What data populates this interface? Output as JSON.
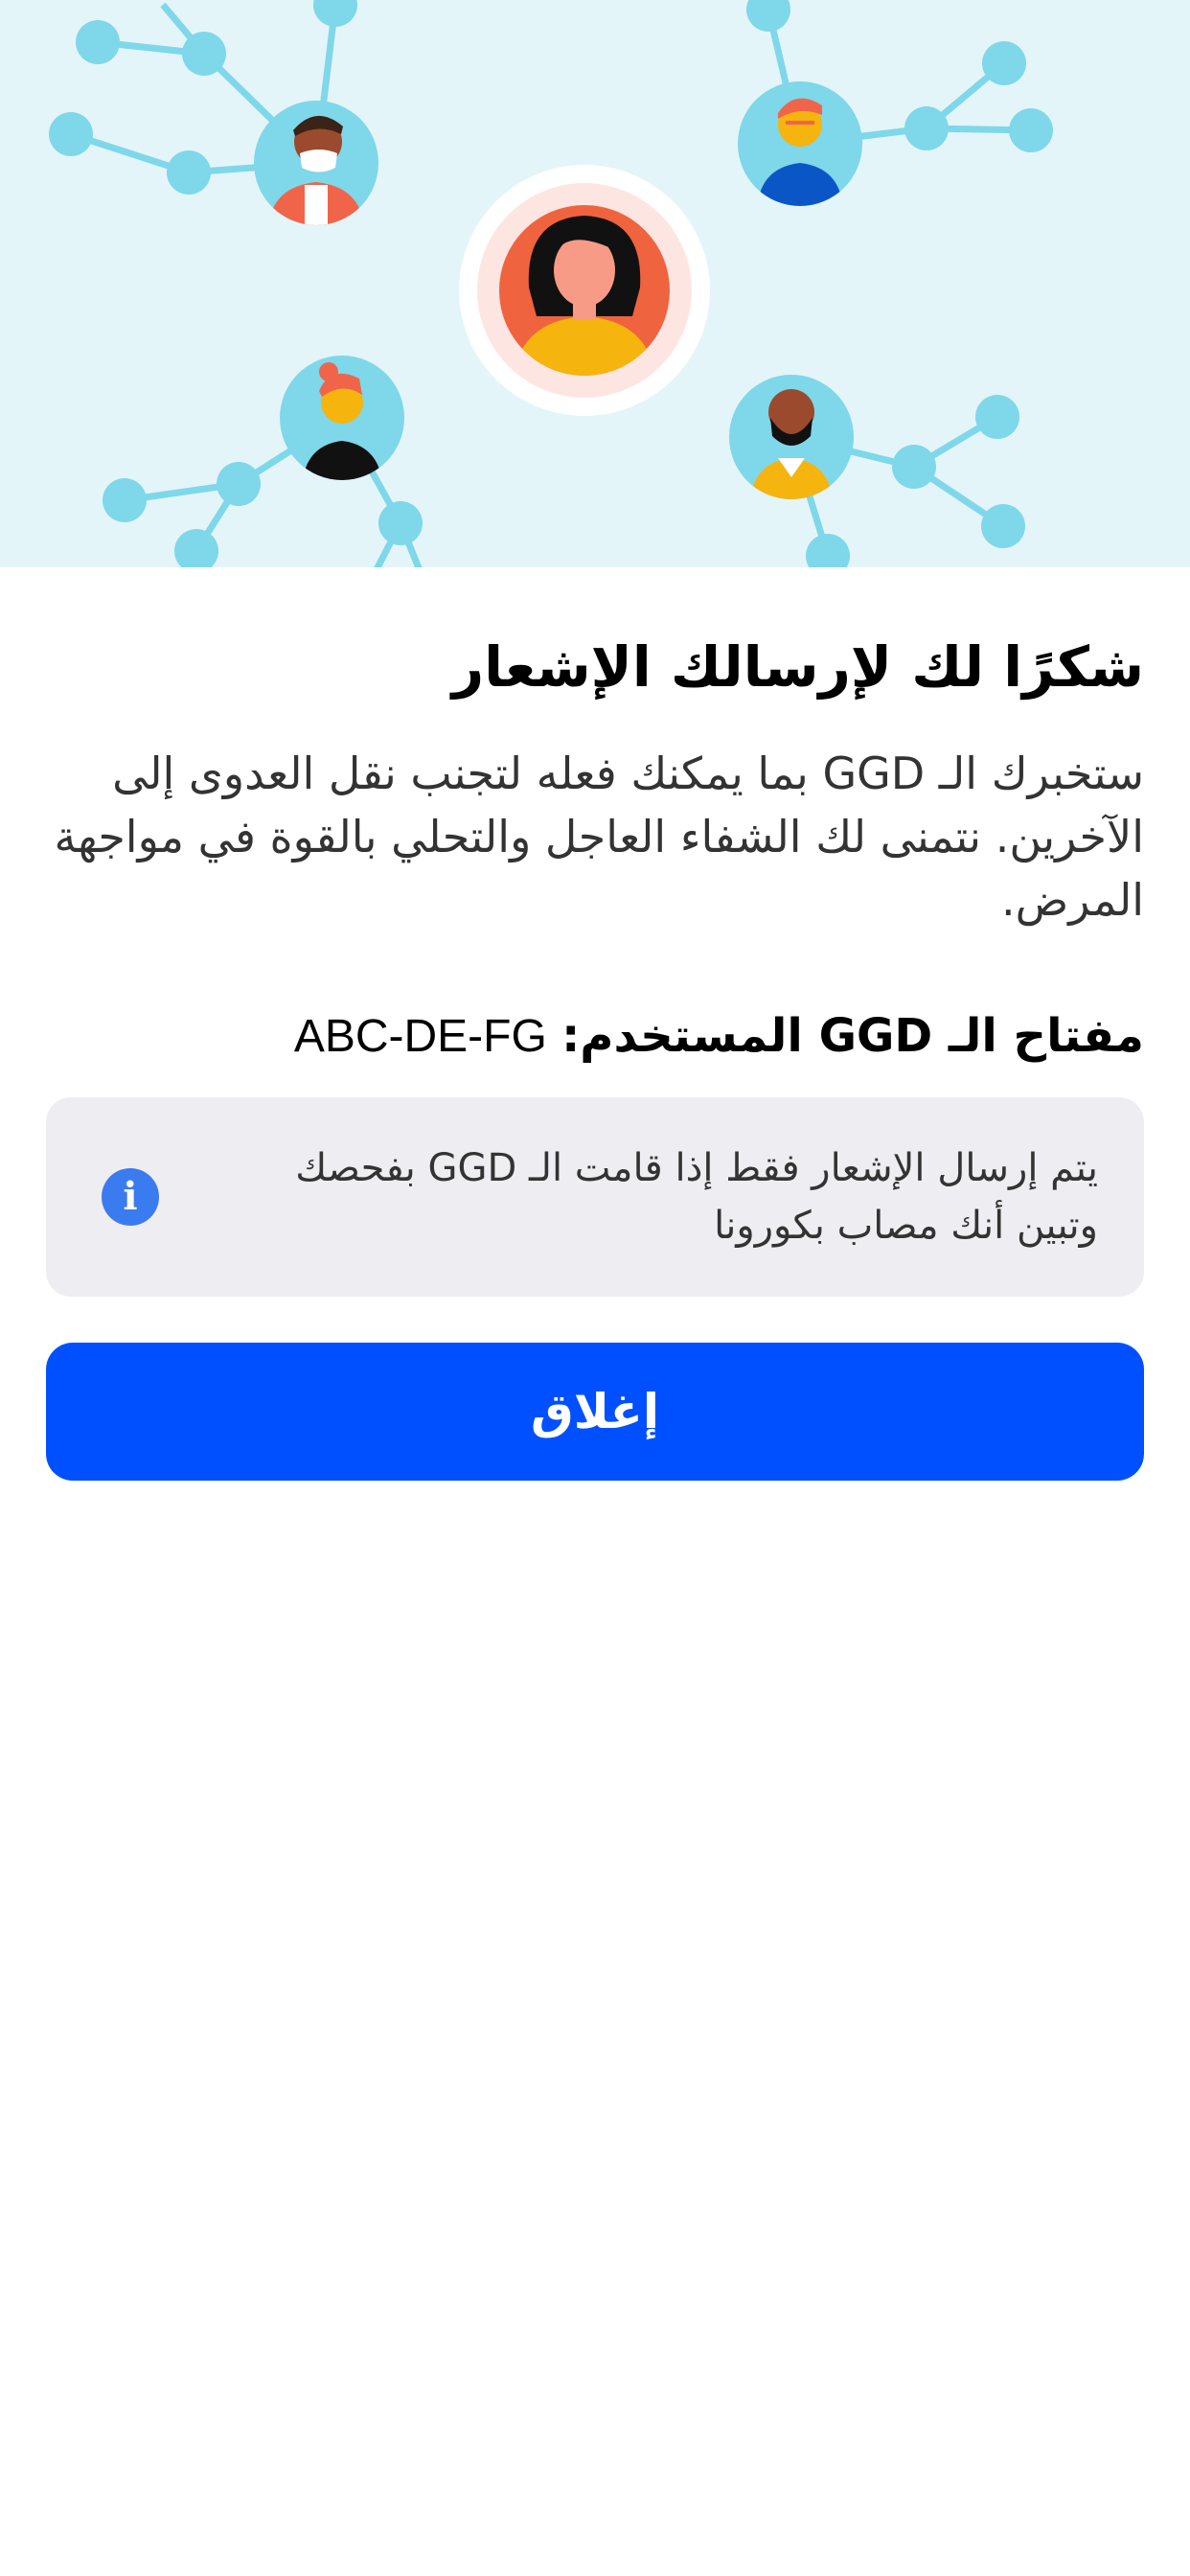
{
  "hero": {
    "illustration": "contact-network-illustration"
  },
  "content": {
    "title": "شكرًا لك لإرسالك الإشعار",
    "body": "ستخبرك الـ GGD بما يمكنك فعله لتجنب نقل العدوى إلى الآخرين. نتمنى لك الشفاء العاجل والتحلي بالقوة في مواجهة المرض.",
    "key_label": "مفتاح الـ GGD المستخدم:",
    "key_value": "ABC-DE-FG"
  },
  "info": {
    "icon": "info-icon",
    "text": "يتم إرسال الإشعار فقط إذا قامت الـ GGD بفحصك وتبين أنك مصاب بكورونا"
  },
  "actions": {
    "close_label": "إغلاق"
  },
  "colors": {
    "hero_background": "#e3f5f9",
    "node": "#7fd7ea",
    "primary_button": "#0050ff",
    "info_icon": "#3b7bf0",
    "info_card": "#eeeef2"
  }
}
